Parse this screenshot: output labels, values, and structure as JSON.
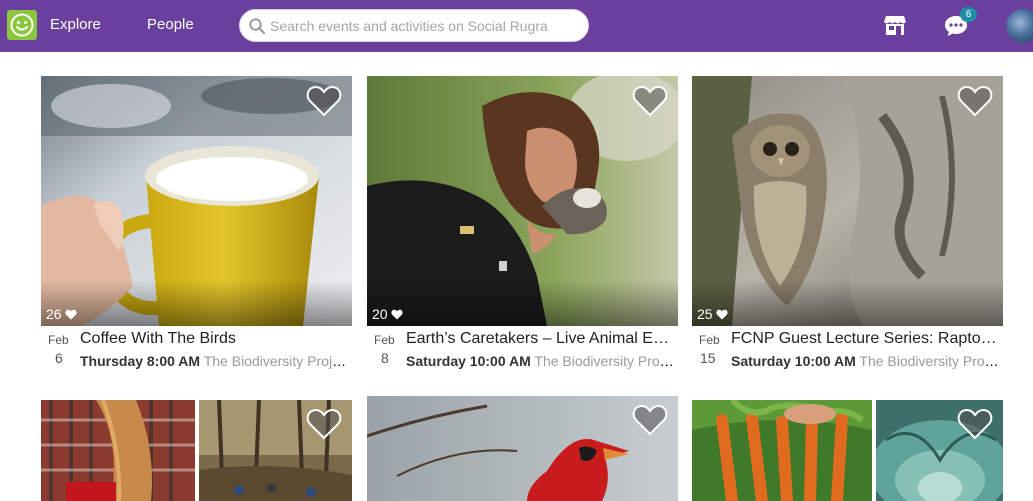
{
  "header": {
    "nav": {
      "explore": "Explore",
      "people": "People"
    },
    "search": {
      "placeholder": "Search events and activities on Social Rugra"
    },
    "chat_badge": "6",
    "icons": {
      "logo": "smiley-logo-icon",
      "search": "search-icon",
      "store": "store-icon",
      "chat": "chat-bubble-icon"
    },
    "colors": {
      "bar": "#6a3f9e",
      "logo": "#8cc63f",
      "badge": "#1e8fa6"
    }
  },
  "events": [
    {
      "likes": "26",
      "month": "Feb",
      "day": "6",
      "title": "Coffee With The Birds",
      "time": "Thursday 8:00 AM",
      "place": "The Biodiversity Project Center"
    },
    {
      "likes": "20",
      "month": "Feb",
      "day": "8",
      "title": "Earth’s Caretakers – Live Animal Encounter",
      "time": "Saturday 10:00 AM",
      "place": "The Biodiversity Project Center"
    },
    {
      "likes": "25",
      "month": "Feb",
      "day": "15",
      "title": "FCNP Guest Lecture Series: Raptors of the Region",
      "time": "Saturday 10:00 AM",
      "place": "The Biodiversity Project Center"
    }
  ]
}
